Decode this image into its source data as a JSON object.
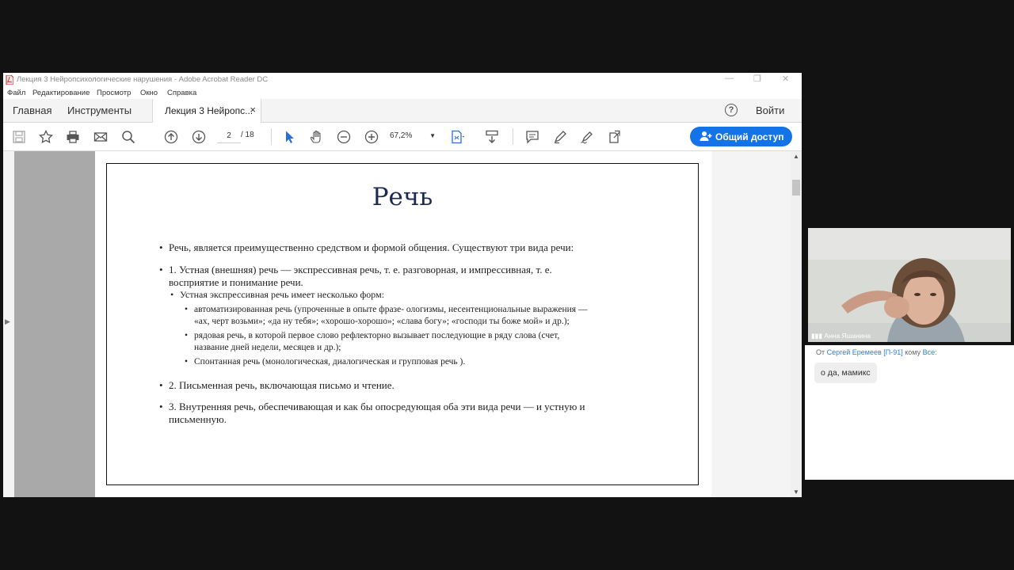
{
  "window": {
    "title": "Лекция 3 Нейропсихологические нарушения - Adobe Acrobat Reader DC"
  },
  "menu": [
    "Файл",
    "Редактирование",
    "Просмотр",
    "Окно",
    "Справка"
  ],
  "tabs": {
    "home": "Главная",
    "tools": "Инструменты",
    "document": "Лекция 3 Нейропс...",
    "close": "×"
  },
  "header_right": {
    "help": "?",
    "signin": "Войти"
  },
  "toolbar": {
    "page_current": "2",
    "page_total": "/ 18",
    "zoom": "67,2%",
    "share_label": "Общий доступ"
  },
  "slide": {
    "title": "Речь",
    "bullets": [
      {
        "level": 1,
        "lines": [
          "Речь, является преимущественно средством и формой общения. Существуют три вида речи:"
        ]
      },
      {
        "level": 1,
        "lines": [
          "1. Устная (внешняя) речь — экспрессивная речь, т. е. разговорная, и импрессивная, т. е.",
          "восприятие и понимание речи."
        ]
      },
      {
        "level": 2,
        "lines": [
          "Устная экспрессивная речь имеет несколько форм:"
        ]
      },
      {
        "level": 3,
        "lines": [
          "автоматизированная речь (упроченные в опыте фразе- ологизмы, несентенциональные выражения —",
          "«ах, черт возьми»; «да ну тебя»; «хорошо-хорошо»; «слава богу»; «господи ты боже мой» и др.);"
        ]
      },
      {
        "level": 3,
        "lines": [
          "рядовая речь, в которой первое слово рефлекторно вызывает последующие в ряду слова (счет,",
          "название дней недели, месяцев и др.);"
        ]
      },
      {
        "level": 3,
        "lines": [
          "Спонтанная речь (монологическая, диалогическая и групповая речь )."
        ]
      },
      {
        "level": 1,
        "lines": [
          "2. Письменная речь, включающая письмо и чтение."
        ]
      },
      {
        "level": 1,
        "lines": [
          "3. Внутренняя речь, обеспечивающая и как бы опосредующая оба эти вида речи — и устную и",
          "письменную."
        ]
      }
    ]
  },
  "video": {
    "participant_name": "Анна Яшанина"
  },
  "chat": {
    "from_label": "От",
    "sender": "Сергей Еремеев [П-91]",
    "to_label": "кому",
    "recipient": "Все:",
    "message": "о да, мамикс"
  },
  "colors": {
    "accent": "#1473e6",
    "slide_title": "#1b2a4e",
    "chat_link": "#2b7fd4"
  }
}
